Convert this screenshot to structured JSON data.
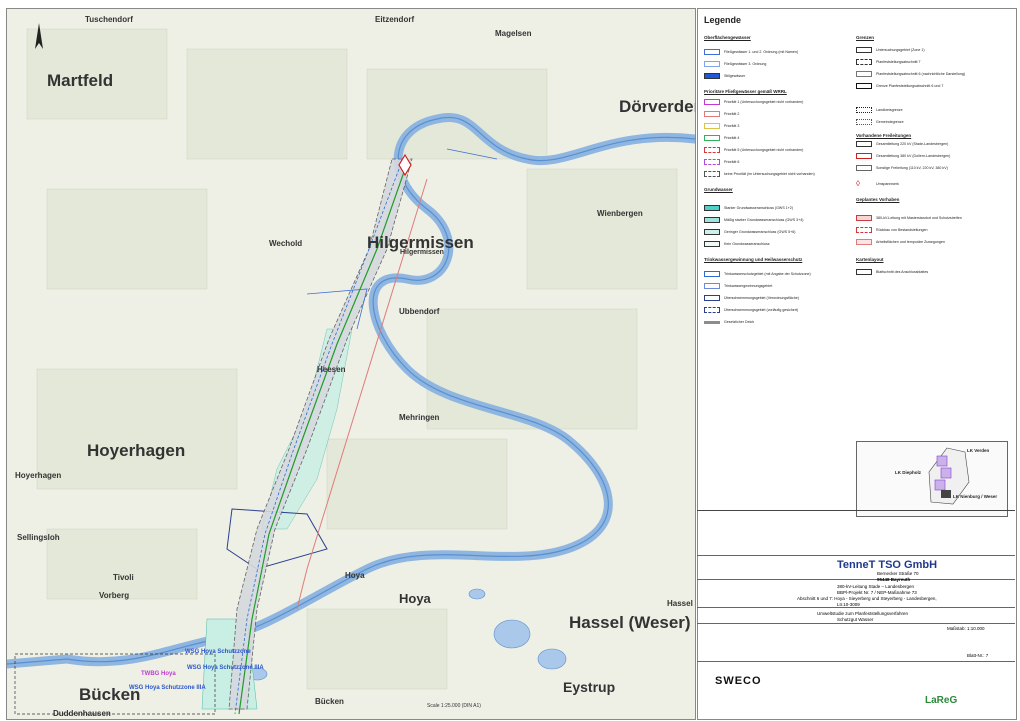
{
  "map": {
    "places_large": [
      "Martfeld",
      "Dörverden",
      "Hilgermissen",
      "Hoyerhagen",
      "Hassel (Weser)",
      "Bücken",
      "Eystrup",
      "Hoya"
    ],
    "places_medium": [
      "Tuschendorf",
      "Eitzendorf",
      "Magelsen",
      "Wienbergen",
      "Wechold",
      "Hilgermissen",
      "Ubbendorf",
      "Heesen",
      "Mehringen",
      "Hoyerhagen",
      "Sellingsloh",
      "Tivoli",
      "Hoya",
      "Vorberg",
      "Hassel",
      "Bücken",
      "Duddenhausen"
    ],
    "protection_labels": [
      "WSG Hoya Schutzzone",
      "WSG Hoya Schutzzone IIIA",
      "TWBG Hoya",
      "WSG Hoya Schutzzone IIIA"
    ],
    "scale_note": "Scale 1:25.000 (DIN A1)"
  },
  "legend": {
    "title": "Legende",
    "section_water": "Oberflächengewässer",
    "section_borders": "Grenzen",
    "section_groundwater": "Grundwasser",
    "section_priority": "Prioritäre Fließgewässer gemäß WRRL",
    "section_existing": "Vorhandene Freileitungen",
    "section_planned": "Geplantes Vorhaben",
    "section_drinking": "Trinkwassergewinnung und Heilwasserschutz",
    "section_map": "Kartenlayout",
    "rows_water": [
      "Fließgewässer 1. und 2. Ordnung (mit Namen)",
      "Fließgewässer 3. Ordnung",
      "Stillgewässer",
      "Priorität 1 (Untersuchungsgebiet nicht vorhanden)",
      "Priorität 2",
      "Priorität 3",
      "Priorität 4",
      "Priorität 5 (Untersuchungsgebiet nicht vorhanden)",
      "Priorität 6",
      "keine Priorität (im Untersuchungsgebiet nicht vorhanden)"
    ],
    "rows_borders": [
      "Untersuchungsgebiet (Zone 1)",
      "Planfeststellungsabschnitt 7",
      "Planfeststellungsabschnitt 6 (nachrichtliche Darstellung)",
      "Grenze Planfeststellungsabschnitt 6 und 7",
      "Landkreisgrenze",
      "Gemeindegrenze",
      "Gesamtleitung 220 kV (Stade-Landesbergen)",
      "Gesamtleitung 380 kV (Dollern-Landesbergen)",
      "Sonstige Freileitung (110 kV, 220 kV, 380 kV)",
      "Umspannwerk"
    ],
    "rows_groundwater": [
      "Starker Grundwasseranschluss (GWS 1+2)",
      "Mäßig starker Grundwasseranschluss (GWS 3+4)",
      "Geringer Grundwasseranschluss (GWS 5+6)",
      "Kein Grundwasseranschluss"
    ],
    "rows_planned": [
      "380-kV-Leitung mit Masterstandort und Schutzstreifen",
      "Rückbau von Bestandsleitungen",
      "Arbeitsflächen und temporäre Zuwegungen"
    ],
    "rows_drinking": [
      "Trinkwasserschutzgebiet (mit Angabe der Schutzzone)",
      "Trinkwassergewinnungsgebiet",
      "Überschwemmungsgebiet (Verordnungsfläche)",
      "Überschwemmungsgebiet (vorläufig gesichert)",
      "Gesetzlicher Deich"
    ],
    "row_map": "Blattschnitt des Anschlussblattes",
    "overview_labels": [
      "LK Verden",
      "LK Diepholz",
      "LK Nienburg / Weser"
    ]
  },
  "titleblock": {
    "company": "TenneT TSO GmbH",
    "address1": "Bernecker Straße 70",
    "address2": "95448 Bayreuth",
    "project_l1": "380-kV-Leitung Stade – Landesbergen",
    "project_l2": "BBPl-Projekt Nr. 7 / NEP-Maßnahme 73",
    "project_l3": "Abschnitt 6 und 7: Hoya - Sieyerberg und Steyerberg - Landesbergen,",
    "project_l4": "Ltr.10-3009",
    "topic_l1": "Umweltstudie zum Planfeststellungsverfahren",
    "topic_l2": "Schutzgut Wasser",
    "blatt": "Blatt-Nr.: 7",
    "scale": "Maßstab: 1:10.000",
    "consultant": "SWECO",
    "partner": "LaReG"
  }
}
